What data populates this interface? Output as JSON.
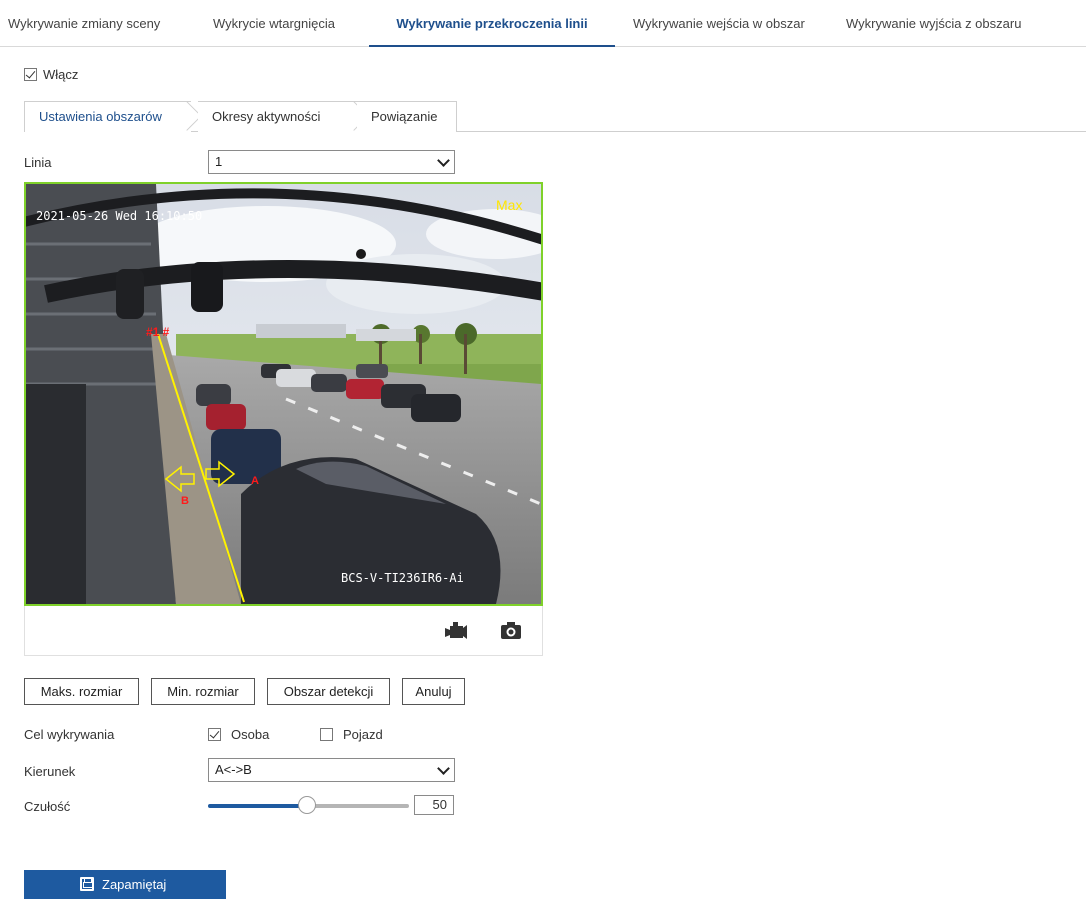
{
  "top_tabs": [
    {
      "label": "Wykrywanie zmiany sceny"
    },
    {
      "label": "Wykrycie wtargnięcia"
    },
    {
      "label": "Wykrywanie przekroczenia linii"
    },
    {
      "label": "Wykrywanie wejścia w obszar"
    },
    {
      "label": "Wykrywanie wyjścia z obszaru"
    }
  ],
  "enable": {
    "label": "Włącz",
    "checked": true
  },
  "sub_tabs": [
    {
      "label": "Ustawienia obszarów"
    },
    {
      "label": "Okresy aktywności"
    },
    {
      "label": "Powiązanie"
    }
  ],
  "line": {
    "label": "Linia",
    "value": "1"
  },
  "video": {
    "timestamp": "2021-05-26 Wed 16:10:50",
    "max_label": "Max",
    "camera_name": "BCS-V-TI236IR6-Ai",
    "line_id": "#1 #",
    "side_a": "A",
    "side_b": "B",
    "record_icon": "video-camera-icon",
    "snapshot_icon": "camera-icon"
  },
  "buttons": {
    "max_size": "Maks. rozmiar",
    "min_size": "Min. rozmiar",
    "detection_area": "Obszar detekcji",
    "cancel": "Anuluj"
  },
  "target": {
    "label": "Cel wykrywania",
    "person": {
      "label": "Osoba",
      "checked": true
    },
    "vehicle": {
      "label": "Pojazd",
      "checked": false
    }
  },
  "direction": {
    "label": "Kierunek",
    "value": "A<->B"
  },
  "sensitivity": {
    "label": "Czułość",
    "value": "50"
  },
  "save": {
    "label": "Zapamiętaj",
    "icon": "floppy-icon"
  },
  "colors": {
    "accent": "#1e4f8c",
    "save_bg": "#1e5aa0",
    "region_border": "#7fd12a",
    "slider_fill": "#1e5aa0"
  }
}
